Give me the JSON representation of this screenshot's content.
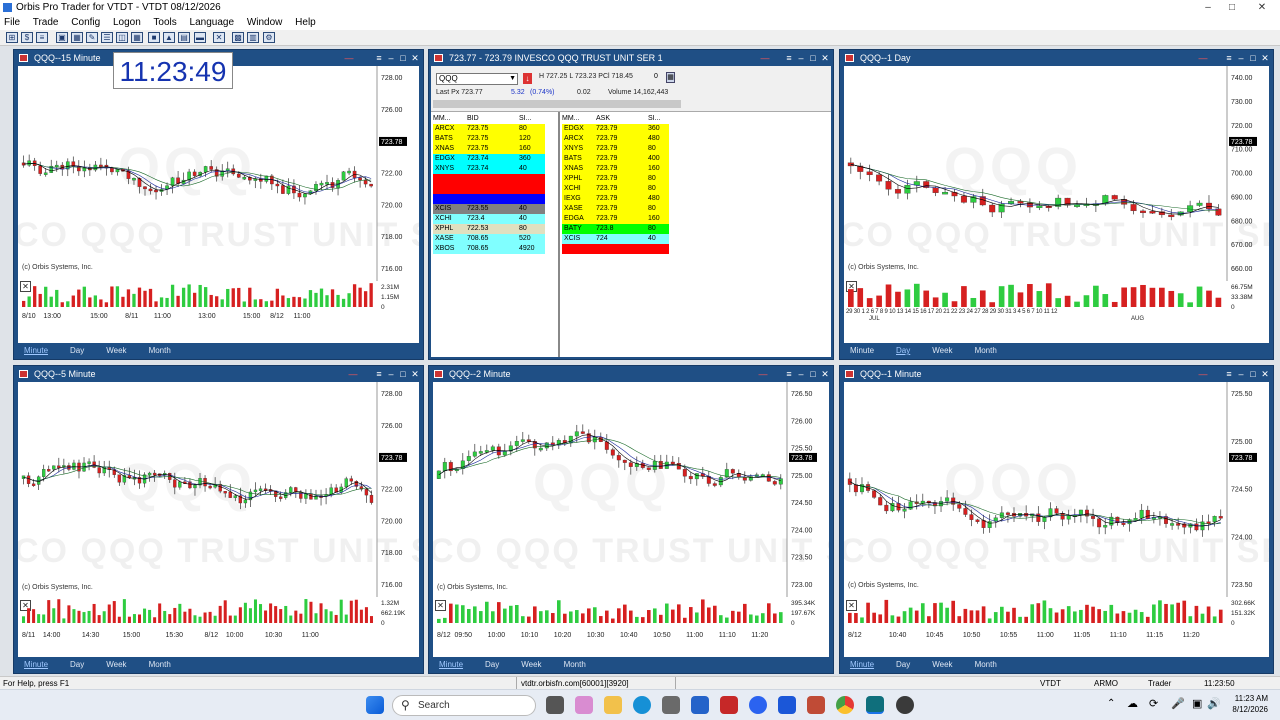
{
  "app": {
    "title": "Orbis Pro Trader for VTDT - VTDT  08/12/2026"
  },
  "menu": [
    "File",
    "Trade",
    "Config",
    "Logon",
    "Tools",
    "Language",
    "Window",
    "Help"
  ],
  "clock": "11:23:49",
  "windows": {
    "w15": {
      "title": "QQQ--15 Minute",
      "price": "723.78",
      "axis": [
        "728.00",
        "726.00",
        "724.00",
        "722.00",
        "720.00",
        "718.00",
        "716.00"
      ],
      "vol_axis": [
        "2.31M",
        "1.15M",
        "0"
      ],
      "dates": [
        "8/10",
        "13:00",
        "15:00",
        "8/11",
        "11:00",
        "13:00",
        "15:00",
        "8/12",
        "11:00"
      ],
      "tabs": [
        "Minute",
        "Day",
        "Week",
        "Month"
      ],
      "selected_tab": "Minute"
    },
    "l2": {
      "title": "723.77 - 723.79    INVESCO QQQ TRUST UNIT SER 1",
      "symbol": "QQQ",
      "hi_lo": "H 727.25   L 723.23 PCl 718.45",
      "zero": "0",
      "last": "Last Px  723.77",
      "change": "5.32",
      "pct": "(0.74%)",
      "spread": "0.02",
      "volume": "Volume  14,162,443",
      "bid_head": [
        "MM...",
        "BID",
        "SI..."
      ],
      "ask_head": [
        "MM...",
        "ASK",
        "SI..."
      ],
      "bids": [
        {
          "mm": "ARCX",
          "px": "723.75",
          "sz": "80",
          "c": "#ffff00"
        },
        {
          "mm": "BATS",
          "px": "723.75",
          "sz": "120",
          "c": "#ffff00"
        },
        {
          "mm": "XNAS",
          "px": "723.75",
          "sz": "160",
          "c": "#ffff00"
        },
        {
          "mm": "EDGX",
          "px": "723.74",
          "sz": "360",
          "c": "#00ffff"
        },
        {
          "mm": "XNYS",
          "px": "723.74",
          "sz": "40",
          "c": "#00ffff"
        },
        {
          "mm": "",
          "px": "",
          "sz": "",
          "c": "#ff0000"
        },
        {
          "mm": "",
          "px": "",
          "sz": "",
          "c": "#ff0000"
        },
        {
          "mm": "",
          "px": "",
          "sz": "",
          "c": "#0000ff"
        },
        {
          "mm": "XCIS",
          "px": "723.55",
          "sz": "40",
          "c": "#808080"
        },
        {
          "mm": "XCHI",
          "px": "723.4",
          "sz": "40",
          "c": "#80ffff"
        },
        {
          "mm": "XPHL",
          "px": "722.53",
          "sz": "80",
          "c": "#e0e0c0"
        },
        {
          "mm": "XASE",
          "px": "708.65",
          "sz": "520",
          "c": "#80ffff"
        },
        {
          "mm": "XBOS",
          "px": "708.65",
          "sz": "4920",
          "c": "#80ffff"
        }
      ],
      "asks": [
        {
          "mm": "EDGX",
          "px": "723.79",
          "sz": "360",
          "c": "#ffff00"
        },
        {
          "mm": "ARCX",
          "px": "723.79",
          "sz": "480",
          "c": "#ffff00"
        },
        {
          "mm": "XNYS",
          "px": "723.79",
          "sz": "80",
          "c": "#ffff00"
        },
        {
          "mm": "BATS",
          "px": "723.79",
          "sz": "400",
          "c": "#ffff00"
        },
        {
          "mm": "XNAS",
          "px": "723.79",
          "sz": "160",
          "c": "#ffff00"
        },
        {
          "mm": "XPHL",
          "px": "723.79",
          "sz": "80",
          "c": "#ffff00"
        },
        {
          "mm": "XCHI",
          "px": "723.79",
          "sz": "80",
          "c": "#ffff00"
        },
        {
          "mm": "IEXG",
          "px": "723.79",
          "sz": "480",
          "c": "#ffff00"
        },
        {
          "mm": "XASE",
          "px": "723.79",
          "sz": "80",
          "c": "#ffff00"
        },
        {
          "mm": "EDGA",
          "px": "723.79",
          "sz": "160",
          "c": "#ffff00"
        },
        {
          "mm": "BATY",
          "px": "723.8",
          "sz": "80",
          "c": "#00ff00"
        },
        {
          "mm": "XCIS",
          "px": "724",
          "sz": "40",
          "c": "#80ffff"
        },
        {
          "mm": "",
          "px": "",
          "sz": "",
          "c": "#ff0000"
        }
      ]
    },
    "wday": {
      "title": "QQQ--1 Day",
      "price": "723.78",
      "axis": [
        "740.00",
        "730.00",
        "720.00",
        "710.00",
        "700.00",
        "690.00",
        "680.00",
        "670.00",
        "660.00"
      ],
      "vol_axis": [
        "66.75M",
        "33.38M",
        "0"
      ],
      "dates": "29 30  1  2  6  7  8  9 10 13 14 15 16 17 20 21 22 23 24 27 28 29 30 31  3  4  5  6  7 10 11 12",
      "months": [
        "JUL",
        "AUG"
      ],
      "tabs": [
        "Minute",
        "Day",
        "Week",
        "Month"
      ],
      "selected_tab": "Day"
    },
    "w5": {
      "title": "QQQ--5 Minute",
      "price": "723.78",
      "axis": [
        "728.00",
        "726.00",
        "724.00",
        "722.00",
        "720.00",
        "718.00",
        "716.00"
      ],
      "vol_axis": [
        "1.32M",
        "662.19K",
        "0"
      ],
      "dates": [
        "8/11",
        "14:00",
        "14:30",
        "15:00",
        "15:30",
        "8/12",
        "10:00",
        "10:30",
        "11:00"
      ],
      "tabs": [
        "Minute",
        "Day",
        "Week",
        "Month"
      ],
      "selected_tab": "Minute"
    },
    "w2": {
      "title": "QQQ--2 Minute",
      "price": "723.78",
      "axis": [
        "726.50",
        "726.00",
        "725.50",
        "725.00",
        "724.50",
        "724.00",
        "723.50",
        "723.00"
      ],
      "vol_axis": [
        "395.34K",
        "197.67K",
        "0"
      ],
      "dates": [
        "8/12",
        "09:50",
        "10:00",
        "10:10",
        "10:20",
        "10:30",
        "10:40",
        "10:50",
        "11:00",
        "11:10",
        "11:20"
      ],
      "tabs": [
        "Minute",
        "Day",
        "Week",
        "Month"
      ],
      "selected_tab": "Minute"
    },
    "w1": {
      "title": "QQQ--1 Minute",
      "price": "723.78",
      "axis": [
        "725.50",
        "725.00",
        "724.50",
        "724.00",
        "723.50"
      ],
      "vol_axis": [
        "302.66K",
        "151.32K",
        "0"
      ],
      "dates": [
        "8/12",
        "10:40",
        "10:45",
        "10:50",
        "10:55",
        "11:00",
        "11:05",
        "11:10",
        "11:15",
        "11:20"
      ],
      "tabs": [
        "Minute",
        "Day",
        "Week",
        "Month"
      ],
      "selected_tab": "Minute"
    }
  },
  "copyright": "(c) Orbis Systems, Inc.",
  "watermark": {
    "sym": "QQQ",
    "name": "CO QQQ TRUST UNIT SE"
  },
  "status": {
    "help": "For Help, press F1",
    "server": "vtdtr.orbisfn.com[60001][3920]",
    "account": "VTDT",
    "user": "ARMO",
    "role": "Trader",
    "time": "11:23:50"
  },
  "taskbar": {
    "search": "Search",
    "time": "11:23 AM",
    "date": "8/12/2026"
  }
}
